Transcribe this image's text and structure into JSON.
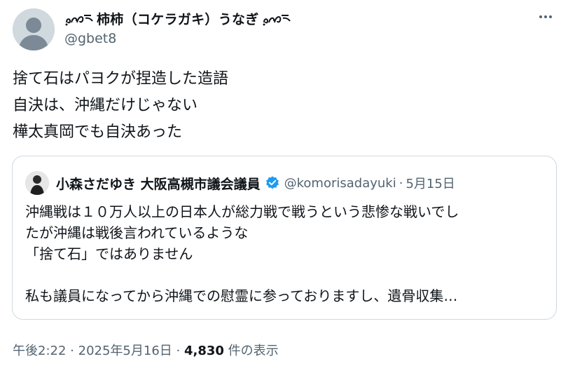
{
  "author": {
    "display_name": "柿柿（コケラガキ）うなぎ",
    "handle": "@gbet8"
  },
  "tweet": {
    "lines": [
      "捨て石はパヨクが捏造した造語",
      "自決は、沖縄だけじゃない",
      "樺太真岡でも自決あった"
    ]
  },
  "quote": {
    "display_name": "小森さだゆき 大阪高槻市議会議員",
    "handle": "@komorisadayuki",
    "separator": "·",
    "date": "5月15日",
    "lines": [
      "沖縄戦は１０万人以上の日本人が総力戦で戦うという悲惨な戦いでし",
      "たが沖縄は戦後言われているような",
      "「捨て石」ではありません",
      "",
      "私も議員になってから沖縄での慰霊に参っておりますし、遺骨収集…"
    ]
  },
  "meta": {
    "time": "午後2:22",
    "sep1": "·",
    "date": "2025年5月16日",
    "sep2": "·",
    "views_count": "4,830",
    "views_label": "件の表示"
  },
  "colors": {
    "text": "#0f1419",
    "secondary": "#536471",
    "border": "#cfd9de",
    "verified": "#1d9bf0"
  },
  "icons": {
    "more": "more-options-icon",
    "verified": "verified-badge-icon",
    "avatar": "default-avatar-icon"
  }
}
